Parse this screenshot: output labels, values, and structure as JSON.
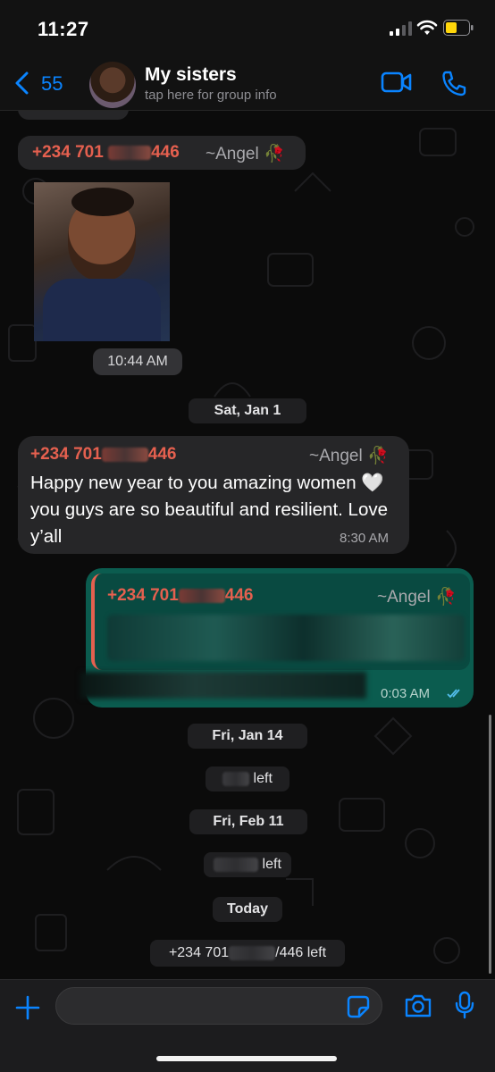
{
  "status": {
    "time": "11:27"
  },
  "header": {
    "back_count": "55",
    "group_name": "My sisters",
    "group_subtitle": "tap here for group info"
  },
  "colors": {
    "accent": "#0a84ff",
    "sender": "#e5604f",
    "outgoing": "#0b5c4f",
    "read_ticks": "#53bdeb"
  },
  "messages": {
    "m1": {
      "sender_prefix": "+234 701",
      "sender_suffix": "446",
      "tag": "~Angel 🥀",
      "time": "10:44 AM"
    },
    "date1": "Sat, Jan 1",
    "m2": {
      "sender_prefix": "+234 701",
      "sender_suffix": "446",
      "tag": "~Angel 🥀",
      "text": "Happy new year to you amazing women 🤍 you guys are so beautiful and resilient. Love y’all",
      "time": "8:30 AM"
    },
    "m3": {
      "sender_prefix": "+234 701",
      "sender_suffix": "446",
      "tag": "~Angel 🥀",
      "time": "0:03 AM"
    },
    "date2": "Fri, Jan 14",
    "sys1": "left",
    "date3": "Fri, Feb 11",
    "sys2": "left",
    "date4": "Today",
    "sys3_prefix": "+234 701",
    "sys3_suffix": "/446 left"
  },
  "input": {
    "placeholder": ""
  },
  "icons": [
    "signal-icon",
    "wifi-icon",
    "battery-icon",
    "back-chevron-icon",
    "video-call-icon",
    "phone-icon",
    "plus-icon",
    "sticker-icon",
    "camera-icon",
    "microphone-icon"
  ]
}
